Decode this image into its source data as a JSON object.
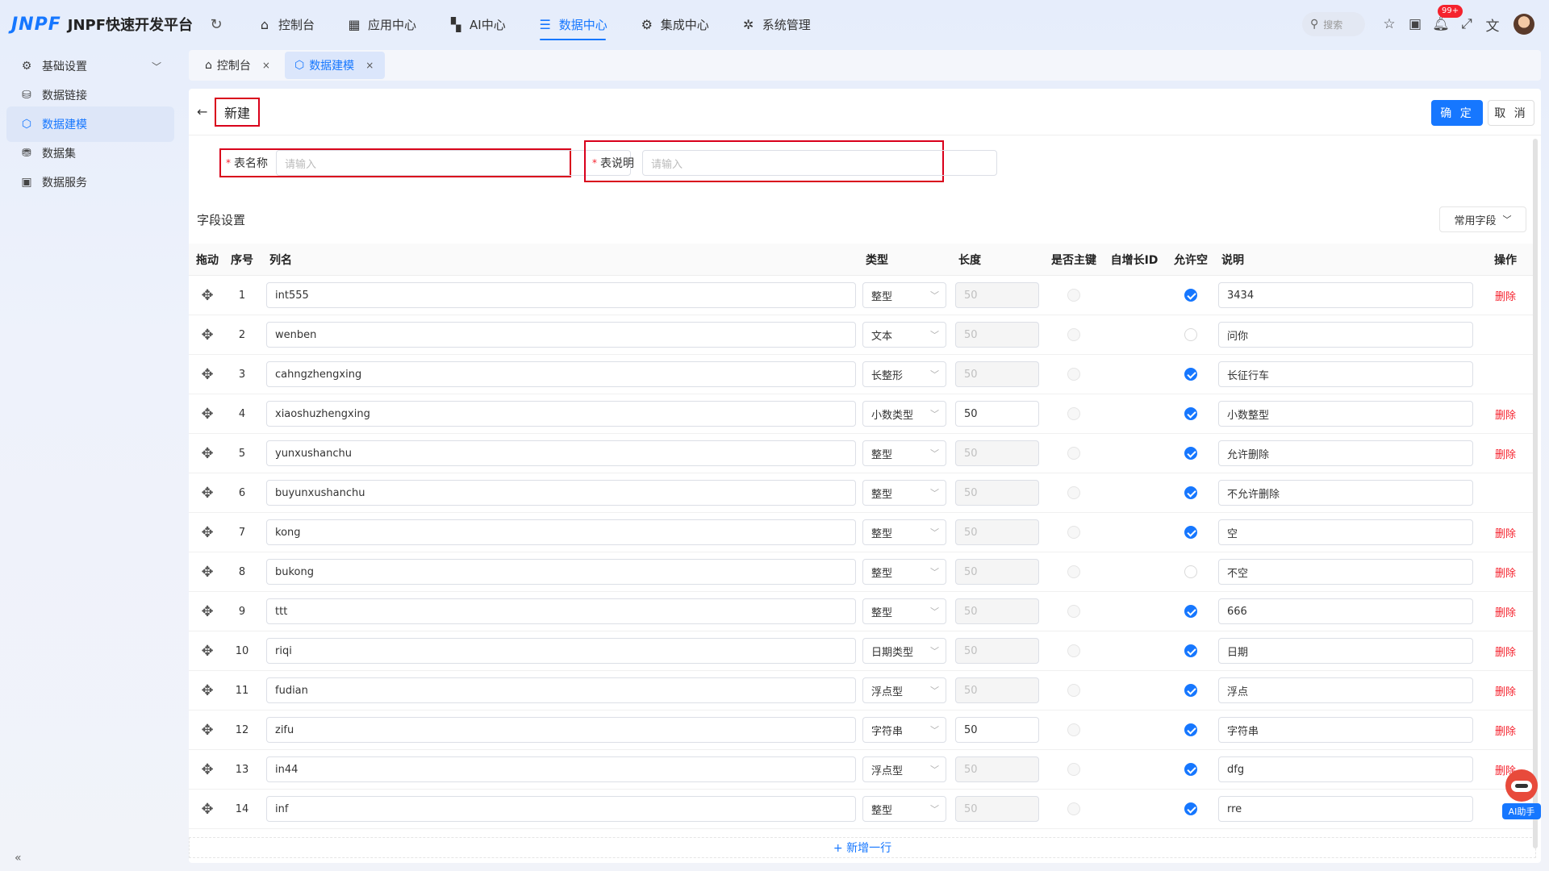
{
  "app": {
    "logo_mark": "JNPF",
    "name": "JNPF快速开发平台"
  },
  "topnav": [
    {
      "label": "控制台",
      "icon": "home-icon"
    },
    {
      "label": "应用中心",
      "icon": "grid-icon"
    },
    {
      "label": "AI中心",
      "icon": "ai-grid-icon"
    },
    {
      "label": "数据中心",
      "icon": "database-icon",
      "active": true
    },
    {
      "label": "集成中心",
      "icon": "integration-icon"
    },
    {
      "label": "系统管理",
      "icon": "gear-icon"
    }
  ],
  "topright": {
    "search_placeholder": "搜索",
    "notification_badge": "99+"
  },
  "sidebar": {
    "items": [
      {
        "label": "基础设置",
        "icon": "settings-icon",
        "expandable": true
      },
      {
        "label": "数据链接",
        "icon": "db-link-icon"
      },
      {
        "label": "数据建模",
        "icon": "model-icon",
        "active": true
      },
      {
        "label": "数据集",
        "icon": "dataset-icon"
      },
      {
        "label": "数据服务",
        "icon": "service-icon"
      }
    ]
  },
  "tabs": [
    {
      "label": "控制台",
      "icon": "home-icon"
    },
    {
      "label": "数据建模",
      "icon": "model-icon",
      "active": true
    }
  ],
  "page": {
    "title": "新建",
    "confirm_label": "确 定",
    "cancel_label": "取 消"
  },
  "form": {
    "table_name_label": "表名称",
    "table_name_placeholder": "请输入",
    "table_desc_label": "表说明",
    "table_desc_placeholder": "请输入"
  },
  "fields_section": {
    "title": "字段设置",
    "common_fields_label": "常用字段",
    "add_row_label": "+ 新增一行"
  },
  "table": {
    "headers": [
      "拖动",
      "序号",
      "列名",
      "类型",
      "长度",
      "是否主键",
      "自增长ID",
      "允许空",
      "说明",
      "操作"
    ],
    "delete_label": "删除",
    "rows": [
      {
        "idx": "1",
        "name": "int555",
        "type": "整型",
        "length": "50",
        "length_enabled": false,
        "nullable": true,
        "desc": "3434",
        "deletable": true
      },
      {
        "idx": "2",
        "name": "wenben",
        "type": "文本",
        "length": "50",
        "length_enabled": false,
        "nullable": false,
        "desc": "问你",
        "deletable": false
      },
      {
        "idx": "3",
        "name": "cahngzhengxing",
        "type": "长整形",
        "length": "50",
        "length_enabled": false,
        "nullable": true,
        "desc": "长征行车",
        "deletable": false
      },
      {
        "idx": "4",
        "name": "xiaoshuzhengxing",
        "type": "小数类型",
        "length": "50",
        "length_enabled": true,
        "nullable": true,
        "desc": "小数整型",
        "deletable": true
      },
      {
        "idx": "5",
        "name": "yunxushanchu",
        "type": "整型",
        "length": "50",
        "length_enabled": false,
        "nullable": true,
        "desc": "允许删除",
        "deletable": true
      },
      {
        "idx": "6",
        "name": "buyunxushanchu",
        "type": "整型",
        "length": "50",
        "length_enabled": false,
        "nullable": true,
        "desc": "不允许删除",
        "deletable": false
      },
      {
        "idx": "7",
        "name": "kong",
        "type": "整型",
        "length": "50",
        "length_enabled": false,
        "nullable": true,
        "desc": "空",
        "deletable": true
      },
      {
        "idx": "8",
        "name": "bukong",
        "type": "整型",
        "length": "50",
        "length_enabled": false,
        "nullable": false,
        "desc": "不空",
        "deletable": true
      },
      {
        "idx": "9",
        "name": "ttt",
        "type": "整型",
        "length": "50",
        "length_enabled": false,
        "nullable": true,
        "desc": "666",
        "deletable": true
      },
      {
        "idx": "10",
        "name": "riqi",
        "type": "日期类型",
        "length": "50",
        "length_enabled": false,
        "nullable": true,
        "desc": "日期",
        "deletable": true
      },
      {
        "idx": "11",
        "name": "fudian",
        "type": "浮点型",
        "length": "50",
        "length_enabled": false,
        "nullable": true,
        "desc": "浮点",
        "deletable": true
      },
      {
        "idx": "12",
        "name": "zifu",
        "type": "字符串",
        "length": "50",
        "length_enabled": true,
        "nullable": true,
        "desc": "字符串",
        "deletable": true
      },
      {
        "idx": "13",
        "name": "in44",
        "type": "浮点型",
        "length": "50",
        "length_enabled": false,
        "nullable": true,
        "desc": "dfg",
        "deletable": true
      },
      {
        "idx": "14",
        "name": "inf",
        "type": "整型",
        "length": "50",
        "length_enabled": false,
        "nullable": true,
        "desc": "rre",
        "deletable": false
      }
    ]
  },
  "ai_helper": {
    "label": "AI助手"
  },
  "colors": {
    "accent": "#1677ff",
    "danger": "#f5222d",
    "highlight_box": "#d9001b"
  }
}
